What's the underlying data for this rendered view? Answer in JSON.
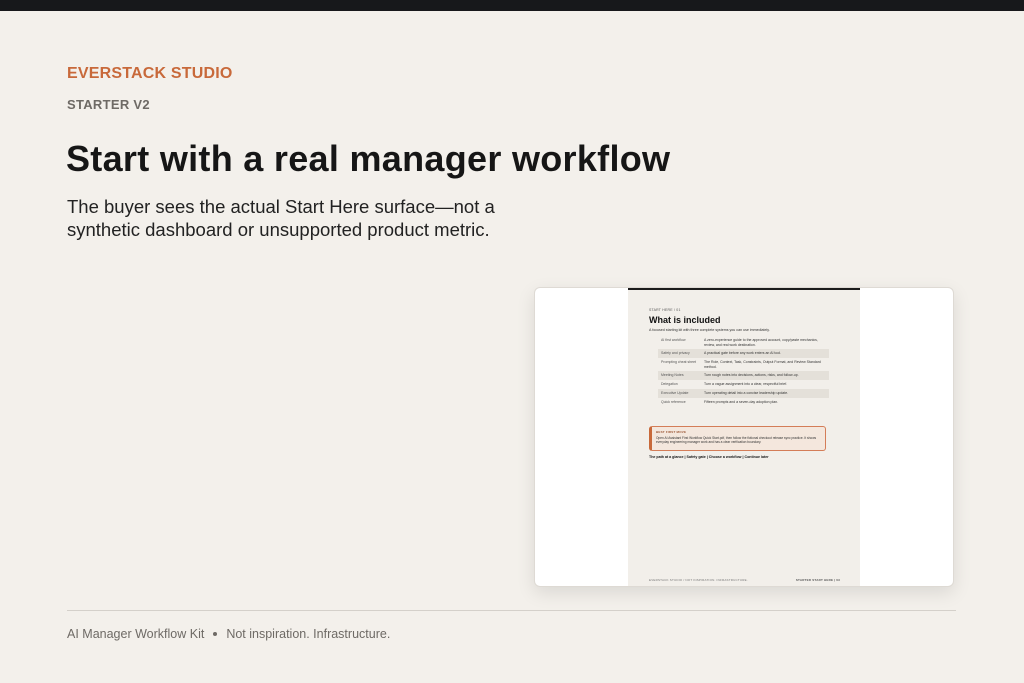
{
  "brand": "EVERSTACK STUDIO",
  "edition": "STARTER V2",
  "headline": "Start with a real manager workflow",
  "subhead": "The buyer sees the actual Start Here surface—not a synthetic dashboard or unsupported product metric.",
  "preview": {
    "eyebrow": "START HERE / 01",
    "title": "What is included",
    "intro": "A focused starting kit with three complete systems you can use immediately.",
    "rows": [
      {
        "name": "AI first workflow",
        "desc": "A zero-experience guide to the approved account, copy/paste mechanics, review, and real work destination."
      },
      {
        "name": "Safety and privacy",
        "desc": "A practical gate before any work enters an AI tool."
      },
      {
        "name": "Prompting cheat sheet",
        "desc": "The Role, Context, Task, Constraints, Output Format, and Review Standard method."
      },
      {
        "name": "Meeting Notes",
        "desc": "Turn rough notes into decisions, actions, risks, and follow-up."
      },
      {
        "name": "Delegation",
        "desc": "Turn a vague assignment into a clear, respectful brief."
      },
      {
        "name": "Executive Update",
        "desc": "Turn operating detail into a concise leadership update."
      },
      {
        "name": "Quick reference",
        "desc": "Fifteen prompts and a seven-day adoption plan."
      }
    ],
    "note_label": "BEST FIRST MOVE",
    "note_text": "Open AI Assistant First Workflow Quick Start.pdf, then follow the fictional checkout release sync practice. It shows everyday engineering manager work and has a clear verification boundary.",
    "path": "The path at a glance | Safety gate | Choose a workflow | Continue later",
    "footer_left": "EVERSTACK STUDIO  /  NOT INSPIRATION. INFRASTRUCTURE.",
    "footer_right": "STARTER START HERE  |  03"
  },
  "footer": {
    "product": "AI Manager Workflow Kit",
    "tagline": "Not inspiration. Infrastructure."
  }
}
